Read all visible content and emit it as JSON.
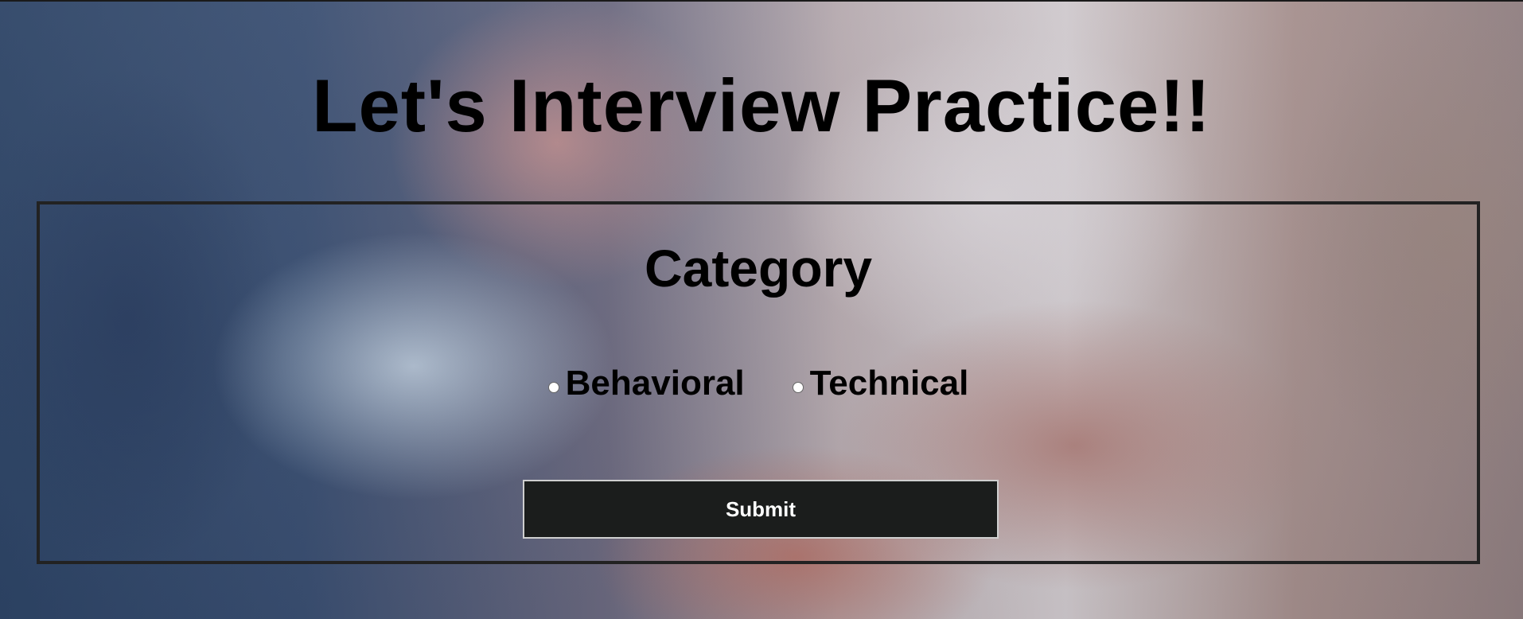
{
  "page": {
    "title": "Let's Interview Practice!!"
  },
  "category": {
    "heading": "Category",
    "options": [
      {
        "label": "Behavioral",
        "selected": false
      },
      {
        "label": "Technical",
        "selected": false
      }
    ]
  },
  "form": {
    "submit_label": "Submit"
  },
  "colors": {
    "text": "#000000",
    "button_bg": "#1b1d1c",
    "button_text": "#ffffff",
    "panel_border": "#222222"
  }
}
